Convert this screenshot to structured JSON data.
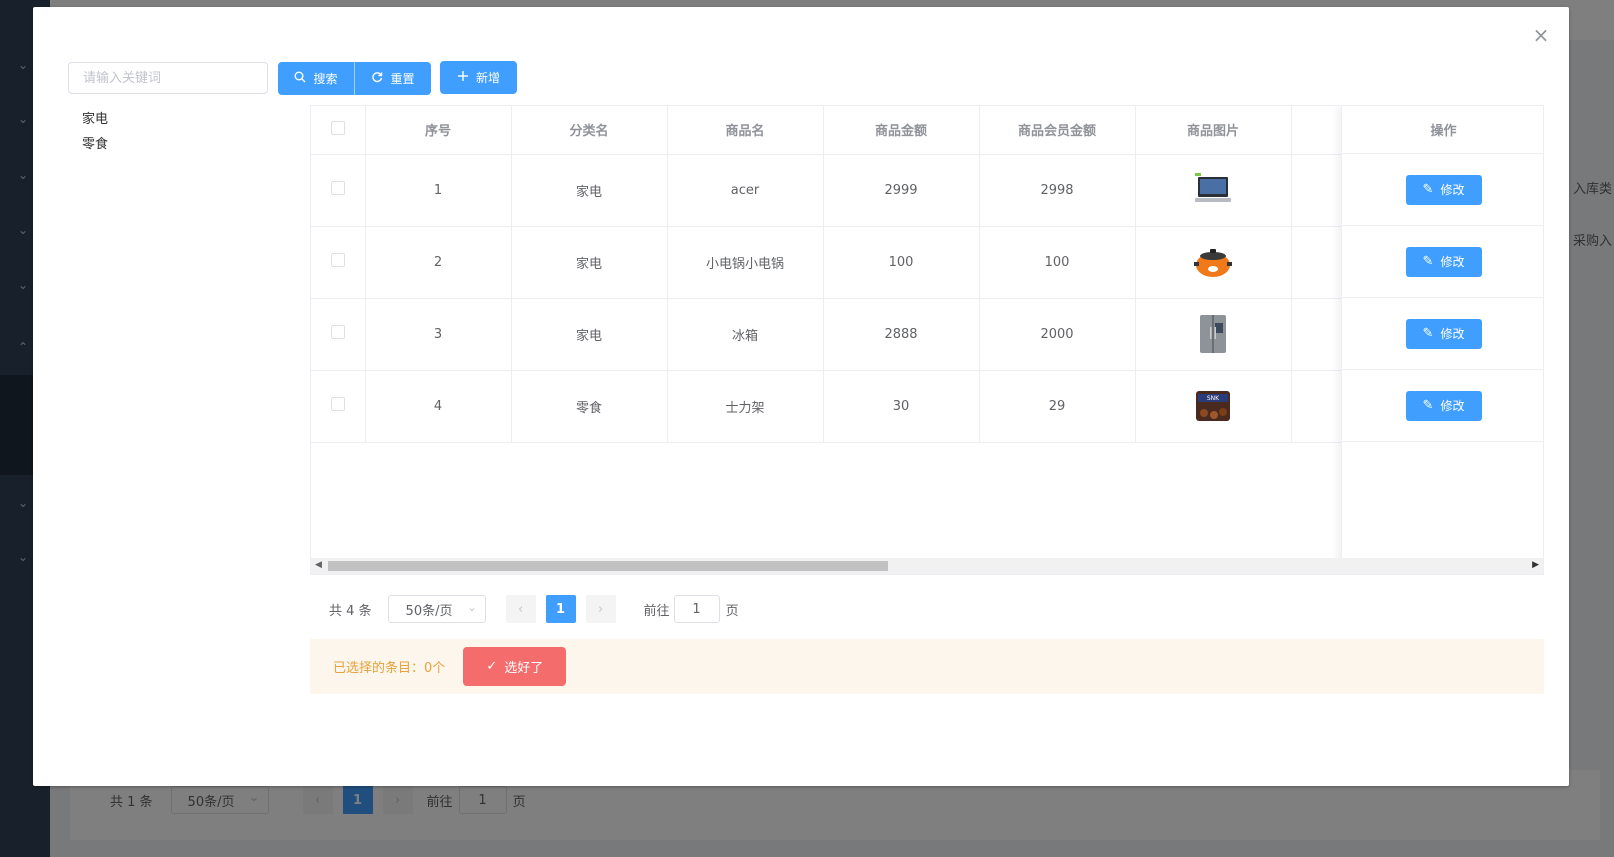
{
  "background": {
    "pager": {
      "total": "共 1 条",
      "size": "50条/页",
      "page": "1",
      "goto": "前往",
      "goto_value": "1",
      "page_suffix": "页"
    },
    "right_labels": [
      "入库类",
      "采购入"
    ]
  },
  "dialog": {
    "close_icon": "close-icon",
    "search": {
      "placeholder": "请输入关键词"
    },
    "buttons": {
      "search": "搜索",
      "reset": "重置",
      "add": "新增"
    },
    "categories": [
      "家电",
      "零食"
    ],
    "table": {
      "columns": [
        "序号",
        "分类名",
        "商品名",
        "商品金额",
        "商品会员金额",
        "商品图片"
      ],
      "action_column": "操作",
      "edit_label": "修改",
      "rows": [
        {
          "index": "1",
          "category": "家电",
          "name": "acer",
          "price": "2999",
          "member_price": "2998",
          "image": "laptop"
        },
        {
          "index": "2",
          "category": "家电",
          "name": "小电锅小电锅",
          "price": "100",
          "member_price": "100",
          "image": "cooker"
        },
        {
          "index": "3",
          "category": "家电",
          "name": "冰箱",
          "price": "2888",
          "member_price": "2000",
          "image": "fridge"
        },
        {
          "index": "4",
          "category": "零食",
          "name": "士力架",
          "price": "30",
          "member_price": "29",
          "image": "snack"
        }
      ]
    },
    "pager": {
      "total": "共 4 条",
      "size": "50条/页",
      "page": "1",
      "goto": "前往",
      "goto_value": "1",
      "page_suffix": "页"
    },
    "selection": {
      "text": "已选择的条目：0个",
      "done": "选好了"
    }
  },
  "colors": {
    "primary": "#409eff",
    "danger": "#f56c6c",
    "warning": "#e6a23c"
  }
}
